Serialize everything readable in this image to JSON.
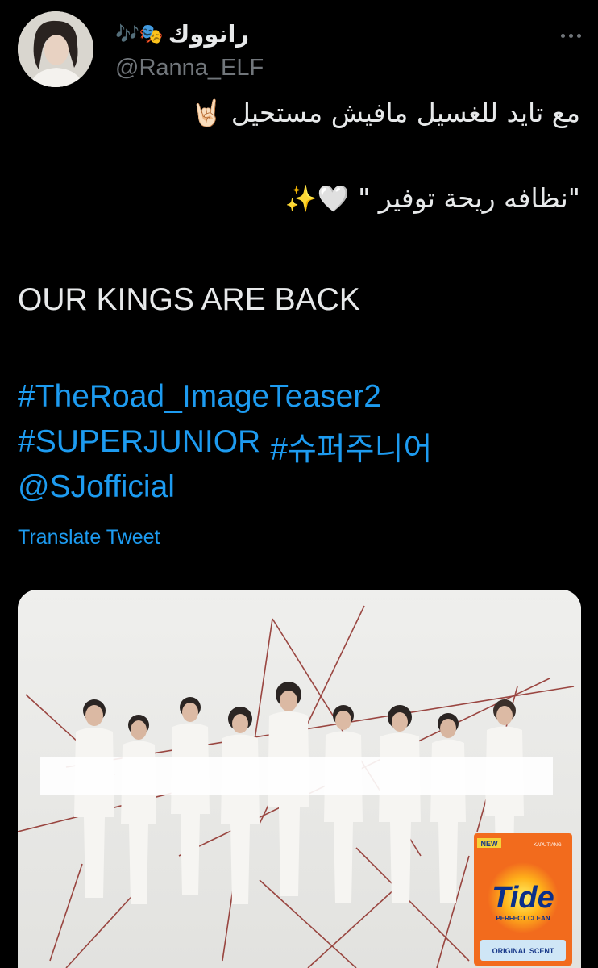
{
  "user": {
    "display_name": "رانووك",
    "display_emoji": "🎶🎭",
    "handle": "@Ranna_ELF"
  },
  "tweet": {
    "line1": "مع تايد للغسيل مافيش مستحيل",
    "line1_emoji": "🤘🏻",
    "line2": "\"نظافه ريحة توفير \"",
    "line2_emoji": "🤍✨",
    "line3": "OUR KINGS ARE BACK",
    "hashtag1": "#TheRoad_ImageTeaser2",
    "hashtag2": "#SUPERJUNIOR",
    "hashtag3": "#슈퍼주니어",
    "mention": "@SJofficial",
    "translate_label": "Translate Tweet"
  },
  "media": {
    "badge_new": "NEW",
    "brand": "Tide",
    "brand_sub": "PERFECT CLEAN",
    "scent": "ORIGINAL SCENT",
    "corner_text": "KAPUTIANG"
  },
  "colors": {
    "background": "#000000",
    "text": "#e7e9ea",
    "secondary": "#71767b",
    "link": "#1d9bf0",
    "tide_orange": "#f26b1d"
  }
}
